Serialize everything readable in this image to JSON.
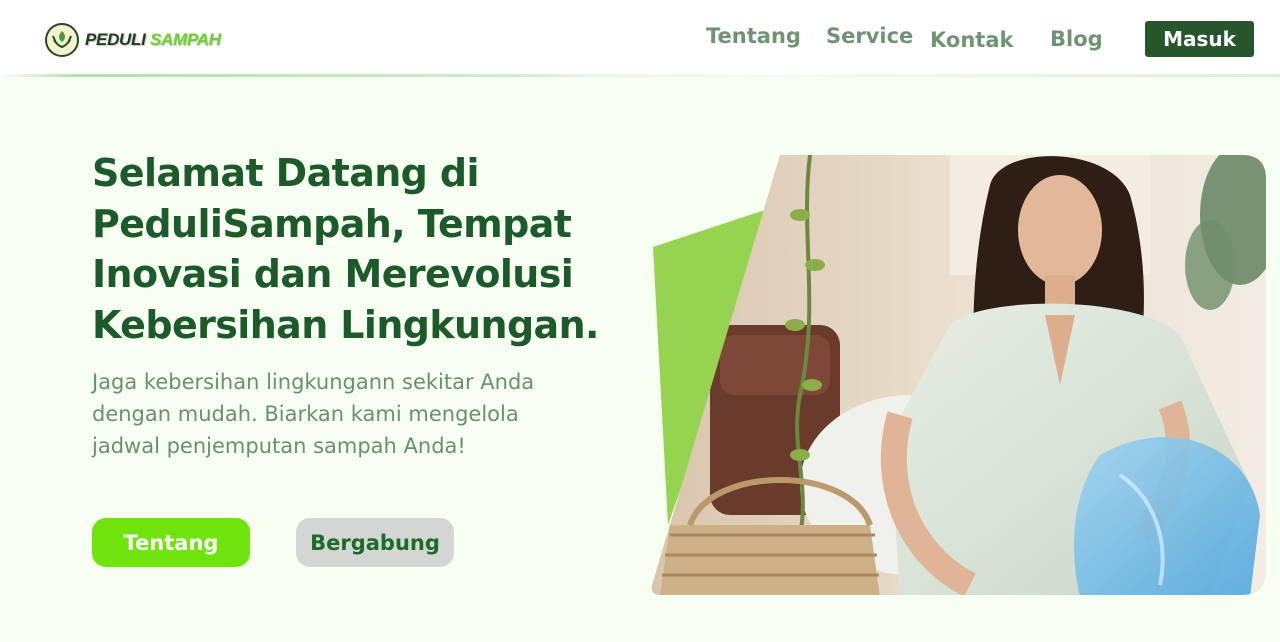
{
  "header": {
    "brand_part1": "PEDULI",
    "brand_part2": "SAMPAH",
    "nav": [
      "Tentang",
      "Service",
      "Kontak",
      "Blog"
    ],
    "login_label": "Masuk"
  },
  "hero": {
    "title_lines": [
      "Selamat Datang di",
      "PeduliSampah, Tempat",
      "Inovasi dan Merevolusi",
      "Kebersihan Lingkungan."
    ],
    "subtitle_lines": [
      "Jaga kebersihan lingkungann sekitar Anda",
      "dengan mudah. Biarkan kami mengelola",
      "jadwal penjemputan sampah Anda!"
    ],
    "primary_button": "Tentang",
    "secondary_button": "Bergabung"
  },
  "colors": {
    "background": "#f6fff2",
    "brand_dark": "#27562c",
    "accent_green": "#6ee30c",
    "nav_text": "#6f9474",
    "title_text": "#1d5a2a"
  },
  "icons": {
    "logo": "leaf-hands-icon"
  }
}
